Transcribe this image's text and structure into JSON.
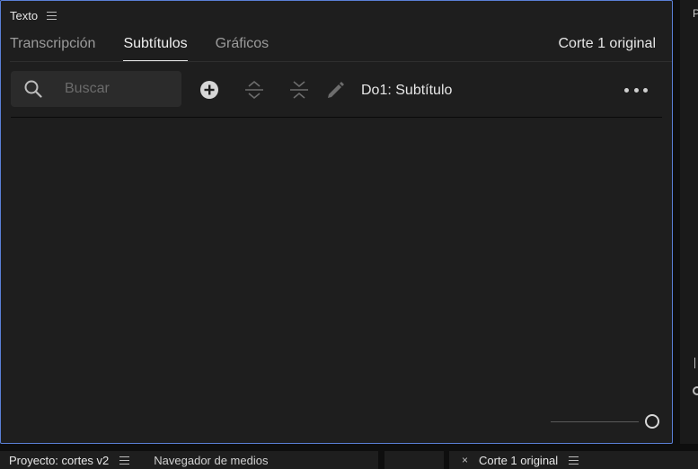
{
  "panel": {
    "title": "Texto"
  },
  "tabs": [
    {
      "label": "Transcripción",
      "active": false
    },
    {
      "label": "Subtítulos",
      "active": true
    },
    {
      "label": "Gráficos",
      "active": false
    }
  ],
  "sequence_label": "Corte 1 original",
  "search": {
    "placeholder": "Buscar",
    "value": ""
  },
  "toolbar": {
    "icons": [
      "add-caption-icon",
      "split-caption-icon",
      "merge-caption-icon",
      "edit-icon",
      "more-icon"
    ],
    "track_label": "Do1: Subtítulo"
  },
  "right_panel": {
    "fragment": "P"
  },
  "bottom_panels": {
    "project_label": "Proyecto: cortes v2",
    "media_browser_label": "Navegador de medios",
    "timeline_label": "Corte 1 original",
    "close_glyph": "×"
  },
  "colors": {
    "accent_border": "#5a7fd6",
    "panel_bg": "#1e1e1e",
    "app_bg": "#0e0e0e"
  }
}
